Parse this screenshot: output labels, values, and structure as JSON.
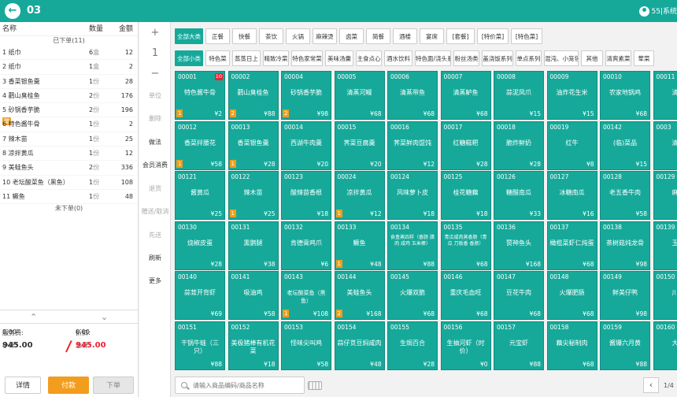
{
  "header": {
    "table_no": "03",
    "user": "55|系统"
  },
  "order": {
    "col_name": "名称",
    "col_qty": "数量",
    "col_amt": "金额",
    "status": "已下单(11)",
    "items": [
      {
        "name": "1 纸巾",
        "qty": "6",
        "unit": "盒",
        "amt": "12",
        "gift": ""
      },
      {
        "name": "2 纸巾",
        "qty": "1",
        "unit": "盒",
        "amt": "2",
        "gift": ""
      },
      {
        "name": "3 香菜银鱼羹",
        "qty": "1",
        "unit": "份",
        "amt": "28",
        "gift": ""
      },
      {
        "name": "4 鹳山臭桂鱼",
        "qty": "2",
        "unit": "份",
        "amt": "176",
        "gift": ""
      },
      {
        "name": "5 砂锅香芋脆",
        "qty": "2",
        "unit": "份",
        "amt": "196",
        "gift": ""
      },
      {
        "name": "6 特色酱牛骨",
        "qty": "1",
        "unit": "份",
        "amt": "2",
        "gift": "赠"
      },
      {
        "name": "7 辣木苗",
        "qty": "1",
        "unit": "份",
        "amt": "25",
        "gift": ""
      },
      {
        "name": "8 凉拌黄瓜",
        "qty": "1",
        "unit": "份",
        "amt": "12",
        "gift": ""
      },
      {
        "name": "9 美蛙鱼头",
        "qty": "2",
        "unit": "份",
        "amt": "336",
        "gift": ""
      },
      {
        "name": "10 老坛酸菜鱼（黑鱼）",
        "qty": "1",
        "unit": "份",
        "amt": "108",
        "gift": ""
      },
      {
        "name": "11 鳜鱼",
        "qty": "1",
        "unit": "份",
        "amt": "48",
        "gift": ""
      }
    ],
    "pending": "未下单(0)",
    "service_label": "服务费:",
    "service": "0.00",
    "discount_label": "折扣:",
    "discount": "0.00",
    "subtotal_label": "小计:",
    "subtotal": "945.00",
    "total_label": "总计:",
    "total": "945.00",
    "btn_detail": "详情",
    "btn_pay": "付款",
    "btn_order": "下单"
  },
  "actions": {
    "plus": "+",
    "qty": "1",
    "minus": "−",
    "unit": "单位",
    "delete": "删除",
    "method": "做法",
    "member": "会员消费",
    "return": "退货",
    "gift": "赠送/取消",
    "serve": "先送",
    "refresh": "刷新",
    "more": "更多"
  },
  "categories": [
    {
      "label": "全部大类",
      "selected": true
    },
    {
      "label": "正餐"
    },
    {
      "label": "快餐"
    },
    {
      "label": "茶饮"
    },
    {
      "label": "火锅"
    },
    {
      "label": "麻辣烫"
    },
    {
      "label": "卤菜"
    },
    {
      "label": "简餐"
    },
    {
      "label": "酒楼"
    },
    {
      "label": "宴席"
    },
    {
      "label": "[套餐]"
    },
    {
      "label": "[特价菜]"
    },
    {
      "label": "[特色菜]"
    }
  ],
  "subcategories": [
    {
      "label": "全部小类",
      "selected": true
    },
    {
      "label": "特色菜"
    },
    {
      "label": "蒸蒸日上"
    },
    {
      "label": "精致冷菜"
    },
    {
      "label": "特色家常菜"
    },
    {
      "label": "美味汤羹"
    },
    {
      "label": "主食点心"
    },
    {
      "label": "酒水饮料"
    },
    {
      "label": "特色面/浇头系列"
    },
    {
      "label": "粉丝汤类"
    },
    {
      "label": "盖浇饭系列"
    },
    {
      "label": "单点系列"
    },
    {
      "label": "混沌、小笼包"
    },
    {
      "label": "其他"
    },
    {
      "label": "清爽素菜"
    },
    {
      "label": "荤菜"
    }
  ],
  "dishes": [
    {
      "code": "00001",
      "name": "特色酱牛骨",
      "price": "¥2",
      "qty": "1",
      "badge": "10"
    },
    {
      "code": "00002",
      "name": "鹳山臭桂鱼",
      "price": "¥88",
      "qty": "2",
      "badge": ""
    },
    {
      "code": "00004",
      "name": "砂锅香芋脆",
      "price": "¥98",
      "qty": "2",
      "badge": ""
    },
    {
      "code": "00005",
      "name": "清蒸河鳗",
      "price": "¥68",
      "qty": "",
      "badge": ""
    },
    {
      "code": "00006",
      "name": "清蒸带鱼",
      "price": "¥68",
      "qty": "",
      "badge": ""
    },
    {
      "code": "00007",
      "name": "清蒸鲈鱼",
      "price": "¥68",
      "qty": "",
      "badge": ""
    },
    {
      "code": "00008",
      "name": "蒜泥凤爪",
      "price": "¥15",
      "qty": "",
      "badge": ""
    },
    {
      "code": "00009",
      "name": "油炸花生米",
      "price": "¥15",
      "qty": "",
      "badge": ""
    },
    {
      "code": "00010",
      "name": "农家地锅鸡",
      "price": "¥68",
      "qty": "",
      "badge": ""
    },
    {
      "code": "00011",
      "name": "清...",
      "price": "",
      "qty": "",
      "badge": ""
    },
    {
      "code": "00012",
      "name": "香菜拌腰花",
      "price": "¥58",
      "qty": "1",
      "badge": ""
    },
    {
      "code": "00013",
      "name": "香菜银鱼羹",
      "price": "¥28",
      "qty": "1",
      "badge": ""
    },
    {
      "code": "00014",
      "name": "西湖牛肉羹",
      "price": "¥20",
      "qty": "",
      "badge": ""
    },
    {
      "code": "00015",
      "name": "荠菜豆腐羹",
      "price": "¥20",
      "qty": "",
      "badge": ""
    },
    {
      "code": "00016",
      "name": "荠菜鲜肉馄饨",
      "price": "¥12",
      "qty": "",
      "badge": ""
    },
    {
      "code": "00017",
      "name": "红糖糍粑",
      "price": "¥28",
      "qty": "",
      "badge": ""
    },
    {
      "code": "00018",
      "name": "脆炸鲜奶",
      "price": "¥28",
      "qty": "",
      "badge": ""
    },
    {
      "code": "00019",
      "name": "红牛",
      "price": "¥8",
      "qty": "",
      "badge": ""
    },
    {
      "code": "00142",
      "name": "(临)菜品",
      "price": "¥15",
      "qty": "",
      "badge": ""
    },
    {
      "code": "0003",
      "name": "清炒",
      "price": "",
      "qty": "",
      "badge": ""
    },
    {
      "code": "00121",
      "name": "酱黄瓜",
      "price": "¥25",
      "qty": "",
      "badge": ""
    },
    {
      "code": "00122",
      "name": "辣木苗",
      "price": "¥25",
      "qty": "1",
      "badge": ""
    },
    {
      "code": "00123",
      "name": "酸辣苗香根",
      "price": "¥18",
      "qty": "",
      "badge": ""
    },
    {
      "code": "00024",
      "name": "凉拌黄瓜",
      "price": "¥12",
      "qty": "1",
      "badge": ""
    },
    {
      "code": "00124",
      "name": "风味萝卜皮",
      "price": "¥18",
      "qty": "",
      "badge": ""
    },
    {
      "code": "00125",
      "name": "桂花糖藕",
      "price": "¥18",
      "qty": "",
      "badge": ""
    },
    {
      "code": "00126",
      "name": "糖醋南瓜",
      "price": "¥33",
      "qty": "",
      "badge": ""
    },
    {
      "code": "00127",
      "name": "冰糖南瓜",
      "price": "¥16",
      "qty": "",
      "badge": ""
    },
    {
      "code": "00128",
      "name": "老五香牛肉",
      "price": "¥58",
      "qty": "",
      "badge": ""
    },
    {
      "code": "00129",
      "name": "麻辣",
      "price": "",
      "qty": "",
      "badge": ""
    },
    {
      "code": "00130",
      "name": "烧椒皮蛋",
      "price": "¥28",
      "qty": "",
      "badge": ""
    },
    {
      "code": "00131",
      "name": "熏鹅腿",
      "price": "¥38",
      "qty": "",
      "badge": ""
    },
    {
      "code": "00132",
      "name": "肯德膏鸡爪",
      "price": "¥6",
      "qty": "",
      "badge": ""
    },
    {
      "code": "00133",
      "name": "鳜鱼",
      "price": "¥48",
      "qty": "1",
      "badge": ""
    },
    {
      "code": "00134",
      "name": "食盒蒸四样（香肠 腊肉 咸鸡 玉米棒）",
      "price": "¥88",
      "qty": "",
      "badge": ""
    },
    {
      "code": "00135",
      "name": "青瓜咸肉蒸香肠（青瓜 刀板香 香肠）",
      "price": "¥68",
      "qty": "",
      "badge": ""
    },
    {
      "code": "00136",
      "name": "赞神鱼头",
      "price": "¥168",
      "qty": "",
      "badge": ""
    },
    {
      "code": "00137",
      "name": "橄榄菜虾仁炖蛋",
      "price": "¥68",
      "qty": "",
      "badge": ""
    },
    {
      "code": "00138",
      "name": "茶树菇炖龙骨",
      "price": "¥98",
      "qty": "",
      "badge": ""
    },
    {
      "code": "00139",
      "name": "玉米",
      "price": "",
      "qty": "",
      "badge": ""
    },
    {
      "code": "00140",
      "name": "蒜茸开背虾",
      "price": "¥69",
      "qty": "",
      "badge": ""
    },
    {
      "code": "00141",
      "name": "吸油鸡",
      "price": "¥58",
      "qty": "",
      "badge": ""
    },
    {
      "code": "00143",
      "name": "老坛酸菜鱼（黑鱼）",
      "price": "¥108",
      "qty": "1",
      "badge": ""
    },
    {
      "code": "00144",
      "name": "美蛙鱼头",
      "price": "¥168",
      "qty": "2",
      "badge": ""
    },
    {
      "code": "00145",
      "name": "火爆双脆",
      "price": "¥68",
      "qty": "",
      "badge": ""
    },
    {
      "code": "00146",
      "name": "重庆毛血旺",
      "price": "¥68",
      "qty": "",
      "badge": ""
    },
    {
      "code": "00147",
      "name": "豆花牛肉",
      "price": "¥68",
      "qty": "",
      "badge": ""
    },
    {
      "code": "00148",
      "name": "火爆肥肠",
      "price": "¥68",
      "qty": "",
      "badge": ""
    },
    {
      "code": "00149",
      "name": "鲜美仔鸭",
      "price": "¥98",
      "qty": "",
      "badge": ""
    },
    {
      "code": "00150",
      "name": "川味",
      "price": "",
      "qty": "",
      "badge": ""
    },
    {
      "code": "00151",
      "name": "干锅牛蛙（三只）",
      "price": "¥88",
      "qty": "",
      "badge": ""
    },
    {
      "code": "00152",
      "name": "美极猪棒有机花菜",
      "price": "¥18",
      "qty": "",
      "badge": ""
    },
    {
      "code": "00153",
      "name": "怪味尖叫鸡",
      "price": "¥58",
      "qty": "",
      "badge": ""
    },
    {
      "code": "00154",
      "name": "蒜仔苋豆焖咸肉",
      "price": "¥48",
      "qty": "",
      "badge": ""
    },
    {
      "code": "00155",
      "name": "生焗百合",
      "price": "¥28",
      "qty": "",
      "badge": ""
    },
    {
      "code": "00156",
      "name": "生抽河虾（时价）",
      "price": "¥0",
      "qty": "",
      "badge": ""
    },
    {
      "code": "00157",
      "name": "元宝虾",
      "price": "¥88",
      "qty": "",
      "badge": ""
    },
    {
      "code": "00158",
      "name": "藕尖秘制肉",
      "price": "¥68",
      "qty": "",
      "badge": ""
    },
    {
      "code": "00159",
      "name": "酱爆六月黄",
      "price": "¥88",
      "qty": "",
      "badge": ""
    },
    {
      "code": "00160",
      "name": "大碗",
      "price": "",
      "qty": "",
      "badge": ""
    }
  ],
  "search": {
    "placeholder": "请输入商品编码/商品名称"
  },
  "pager": {
    "prev": "‹",
    "info": "1/4"
  }
}
